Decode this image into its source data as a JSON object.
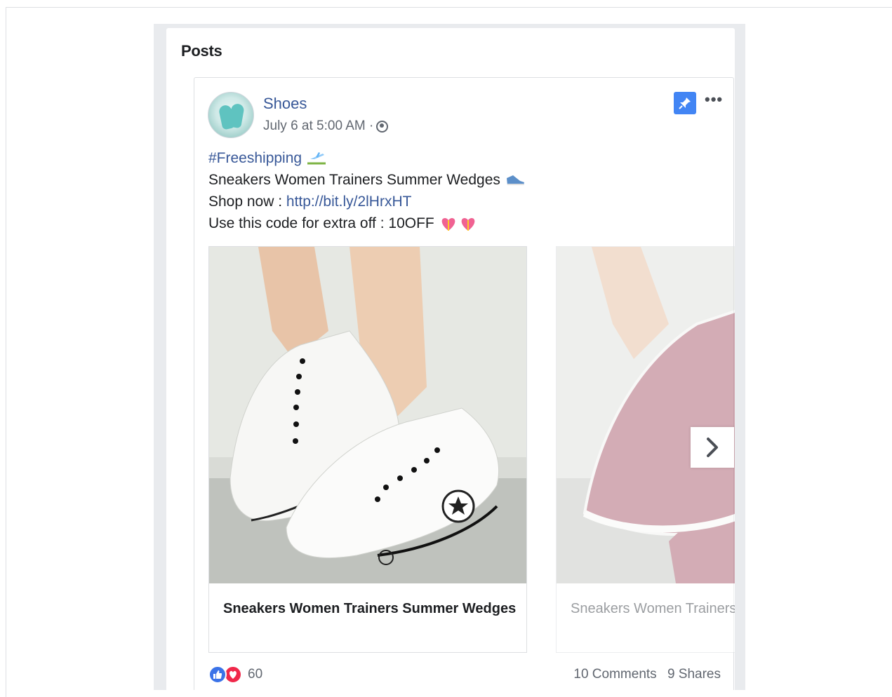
{
  "section": {
    "title": "Posts"
  },
  "post": {
    "page_name": "Shoes",
    "timestamp": "July 6 at 5:00 AM ·",
    "audience_icon": "globe-icon",
    "pin_icon": "pin-icon",
    "more_label": "•••",
    "text": {
      "hashtag": "#Freeshipping",
      "line2": "Sneakers Women Trainers Summer Wedges",
      "shop_label": "Shop now : ",
      "shop_link": "http://bit.ly/2lHrxHT",
      "code_line": "Use this code for extra off : 10OFF"
    },
    "carousel": [
      {
        "caption": "Sneakers Women Trainers Summer Wedges",
        "product_color": "#ffffff"
      },
      {
        "caption": "Sneakers Women Trainers Summer Wedges",
        "product_color": "#b06a7a"
      }
    ],
    "reactions": {
      "types": [
        "like",
        "love"
      ],
      "count": "60"
    },
    "comments": "10 Comments",
    "shares": "9 Shares"
  },
  "colors": {
    "link": "#385898",
    "pin": "#4285f4",
    "like": "#3b73e8",
    "love": "#f0284a"
  }
}
